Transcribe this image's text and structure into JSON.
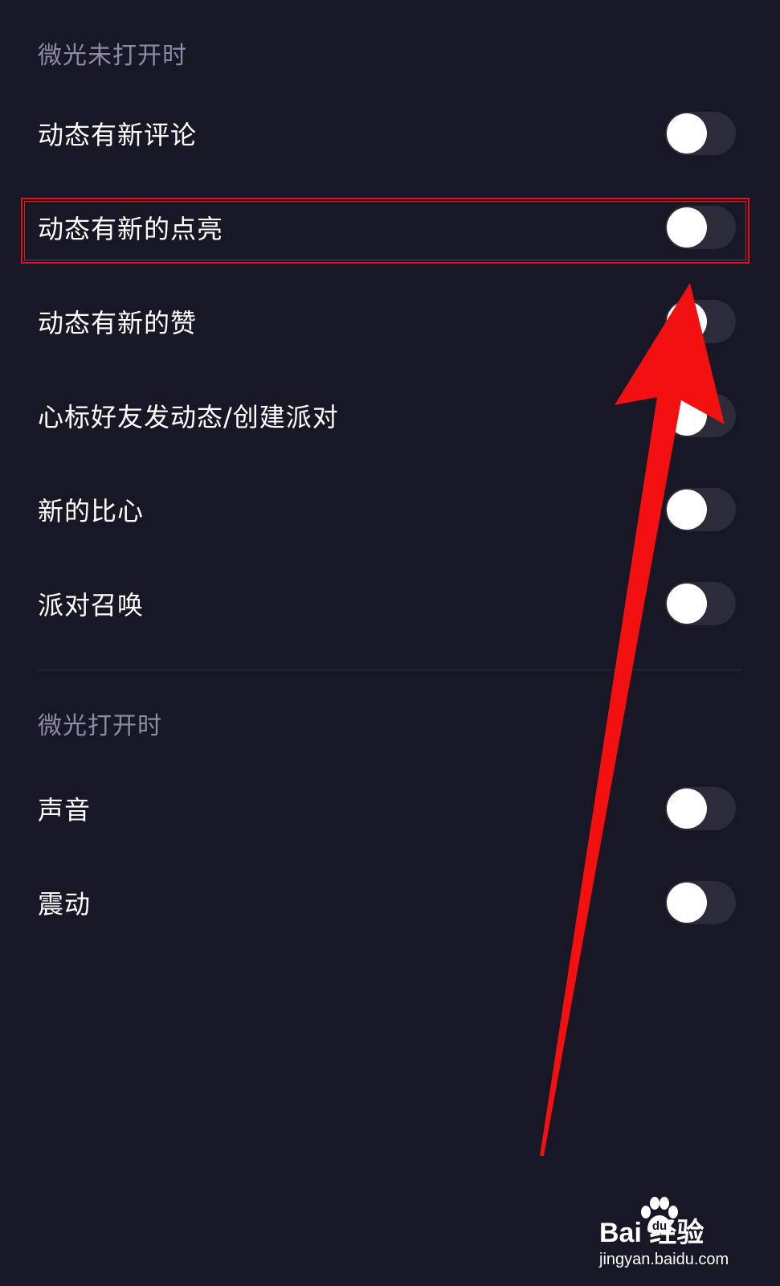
{
  "sections": [
    {
      "header": "微光未打开时",
      "items": [
        {
          "label": "动态有新评论",
          "enabled": false
        },
        {
          "label": "动态有新的点亮",
          "enabled": false
        },
        {
          "label": "动态有新的赞",
          "enabled": false
        },
        {
          "label": "心标好友发动态/创建派对",
          "enabled": false
        },
        {
          "label": "新的比心",
          "enabled": false
        },
        {
          "label": "派对召唤",
          "enabled": false
        }
      ]
    },
    {
      "header": "微光打开时",
      "items": [
        {
          "label": "声音",
          "enabled": false
        },
        {
          "label": "震动",
          "enabled": false
        }
      ]
    }
  ],
  "colors": {
    "background": "#181725",
    "section_header": "#8e8aa8",
    "toggle_track_off": "#2c2b3a",
    "toggle_knob": "#ffffff",
    "annotation_red": "#e0131b"
  },
  "watermark": {
    "brand": "Bai  经验",
    "url": "jingyan.baidu.com"
  }
}
